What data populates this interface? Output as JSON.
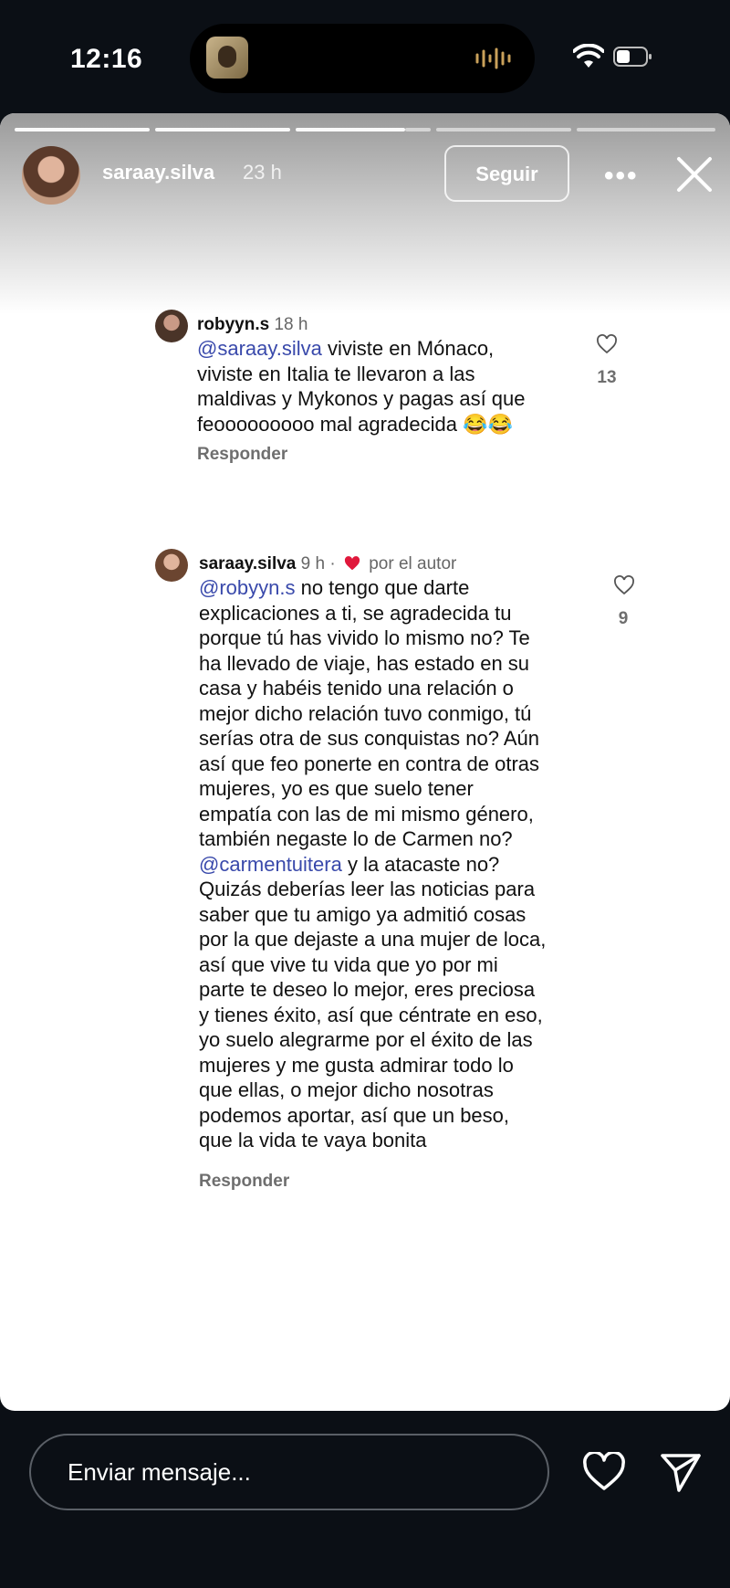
{
  "status_bar": {
    "time": "12:16"
  },
  "story": {
    "username": "saraay.silva",
    "time_ago": "23 h",
    "follow_label": "Seguir",
    "more_label": "•••"
  },
  "comments": [
    {
      "username": "robyyn.s",
      "time": "18 h",
      "mention": "@saraay.silva",
      "text": " viviste en Mónaco,\nviviste en Italia te llevaron a las\nmaldivas y Mykonos y pagas así que\nfeooooooooo mal agradecida 😂😂",
      "likes": "13",
      "reply_label": "Responder"
    },
    {
      "username": "saraay.silva",
      "time": "9 h",
      "author_label": "por el autor",
      "mention": "@robyyn.s",
      "text_before": " no tengo que darte\nexplicaciones a ti, se agradecida tu\nporque tú has vivido lo mismo no? Te\nha llevado de viaje, has estado en su\ncasa y habéis tenido una relación o\nmejor dicho relación tuvo conmigo, tú\nserías otra de sus conquistas no? Aún\nasí que feo ponerte en contra de otras\nmujeres, yo es que suelo tener\nempatía con las de mi mismo género,\ntambién negaste lo de Carmen no?\n",
      "mention2": "@carmentuitera",
      "text_after": " y la atacaste no?\nQuizás deberías leer las noticias para\nsaber que tu amigo ya admitió cosas\npor la que dejaste a una mujer de loca,\nasí que vive tu vida que yo por mi\nparte te deseo lo mejor, eres preciosa\ny tienes éxito, así que céntrate en eso,\nyo suelo alegrarme por el éxito de las\nmujeres y me gusta admirar todo lo\nque ellas, o mejor dicho nosotras\npodemos aportar, así que un beso,\nque la vida te vaya bonita",
      "likes": "9",
      "reply_label": "Responder"
    }
  ],
  "message_bar": {
    "placeholder": "Enviar mensaje..."
  }
}
